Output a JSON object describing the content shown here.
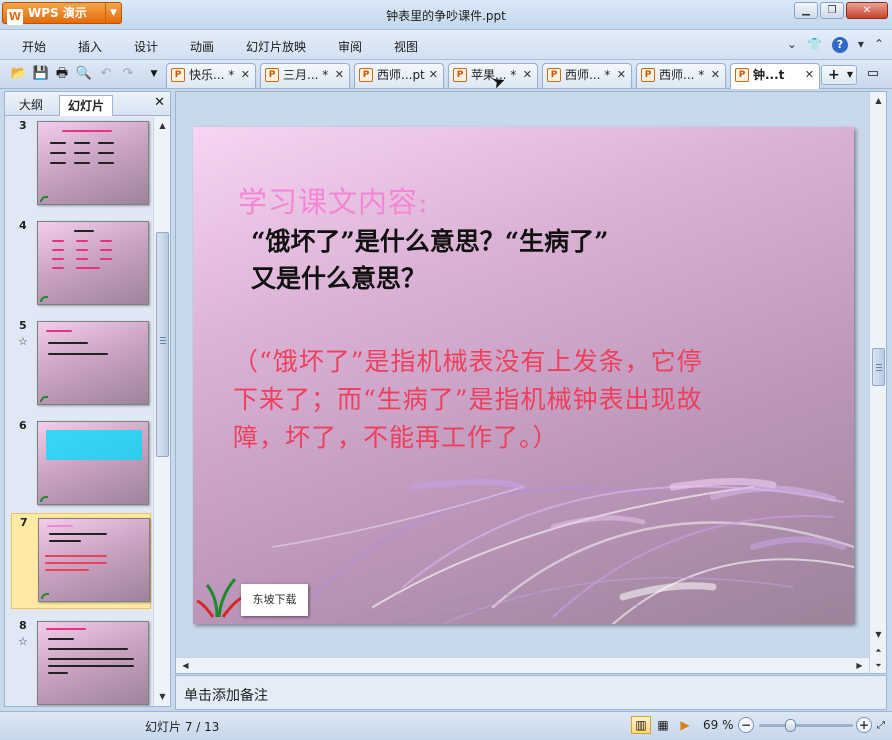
{
  "app": {
    "name": "WPS 演示",
    "doc_title": "钟表里的争吵课件.ppt"
  },
  "menu": [
    {
      "label": "开始"
    },
    {
      "label": "插入"
    },
    {
      "label": "设计"
    },
    {
      "label": "动画"
    },
    {
      "label": "幻灯片放映"
    },
    {
      "label": "审阅"
    },
    {
      "label": "视图"
    }
  ],
  "tabs": [
    {
      "label": "快乐...",
      "modified": "*"
    },
    {
      "label": "三月...",
      "modified": "*"
    },
    {
      "label": "西师...pt",
      "modified": ""
    },
    {
      "label": "苹果...",
      "modified": "*"
    },
    {
      "label": "西师...",
      "modified": "*"
    },
    {
      "label": "西师...",
      "modified": "*"
    },
    {
      "label": "钟...t",
      "modified": ""
    }
  ],
  "panel": {
    "tab_outline": "大纲",
    "tab_slides": "幻灯片"
  },
  "thumbnails": [
    {
      "num": "3",
      "star": ""
    },
    {
      "num": "4",
      "star": ""
    },
    {
      "num": "5",
      "star": "☆"
    },
    {
      "num": "6",
      "star": ""
    },
    {
      "num": "7",
      "star": ""
    },
    {
      "num": "8",
      "star": "☆"
    }
  ],
  "slide": {
    "title": "学习课文内容:",
    "question_line1": "“饿坏了”是什么意思？“生病了”",
    "question_line2": "又是什么意思？",
    "answer_lines": [
      "（“饿坏了”是指机械表没有上发条，它停",
      "下来了；而“生病了”是指机械钟表出现故",
      "障，坏了，不能再工作了。）"
    ],
    "watermark": "东坡下载"
  },
  "notes_placeholder": "单击添加备注",
  "status": {
    "slide_counter": "幻灯片 7 / 13",
    "zoom": "69 %",
    "zoom_level_percent": 69
  },
  "colors": {
    "title_pink": "#f486d6",
    "answer_red": "#ee3f5d",
    "app_orange": "#e26b0d"
  }
}
